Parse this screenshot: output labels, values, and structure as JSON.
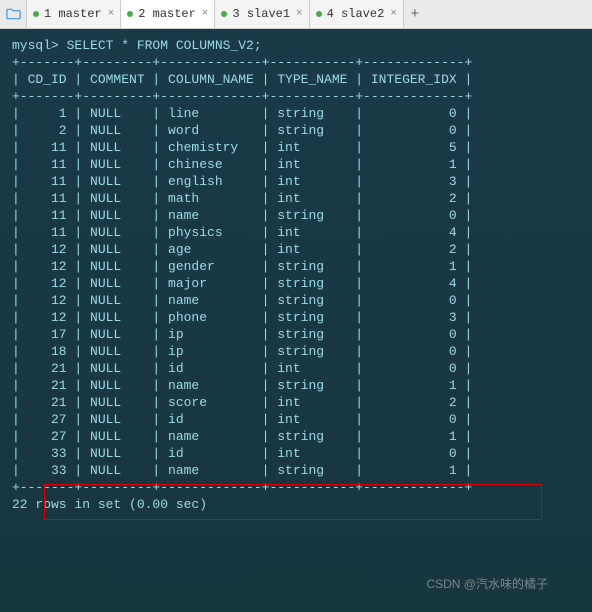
{
  "tabs": [
    {
      "label": "1 master"
    },
    {
      "label": "2 master"
    },
    {
      "label": "3 slave1"
    },
    {
      "label": "4 slave2"
    }
  ],
  "active_tab_index": 1,
  "prompt": "mysql> ",
  "query": "SELECT * FROM COLUMNS_V2;",
  "columns": [
    "CD_ID",
    "COMMENT",
    "COLUMN_NAME",
    "TYPE_NAME",
    "INTEGER_IDX"
  ],
  "rows": [
    {
      "cd_id": 1,
      "comment": "NULL",
      "column_name": "line",
      "type_name": "string",
      "integer_idx": 0
    },
    {
      "cd_id": 2,
      "comment": "NULL",
      "column_name": "word",
      "type_name": "string",
      "integer_idx": 0
    },
    {
      "cd_id": 11,
      "comment": "NULL",
      "column_name": "chemistry",
      "type_name": "int",
      "integer_idx": 5
    },
    {
      "cd_id": 11,
      "comment": "NULL",
      "column_name": "chinese",
      "type_name": "int",
      "integer_idx": 1
    },
    {
      "cd_id": 11,
      "comment": "NULL",
      "column_name": "english",
      "type_name": "int",
      "integer_idx": 3
    },
    {
      "cd_id": 11,
      "comment": "NULL",
      "column_name": "math",
      "type_name": "int",
      "integer_idx": 2
    },
    {
      "cd_id": 11,
      "comment": "NULL",
      "column_name": "name",
      "type_name": "string",
      "integer_idx": 0
    },
    {
      "cd_id": 11,
      "comment": "NULL",
      "column_name": "physics",
      "type_name": "int",
      "integer_idx": 4
    },
    {
      "cd_id": 12,
      "comment": "NULL",
      "column_name": "age",
      "type_name": "int",
      "integer_idx": 2
    },
    {
      "cd_id": 12,
      "comment": "NULL",
      "column_name": "gender",
      "type_name": "string",
      "integer_idx": 1
    },
    {
      "cd_id": 12,
      "comment": "NULL",
      "column_name": "major",
      "type_name": "string",
      "integer_idx": 4
    },
    {
      "cd_id": 12,
      "comment": "NULL",
      "column_name": "name",
      "type_name": "string",
      "integer_idx": 0
    },
    {
      "cd_id": 12,
      "comment": "NULL",
      "column_name": "phone",
      "type_name": "string",
      "integer_idx": 3
    },
    {
      "cd_id": 17,
      "comment": "NULL",
      "column_name": "ip",
      "type_name": "string",
      "integer_idx": 0
    },
    {
      "cd_id": 18,
      "comment": "NULL",
      "column_name": "ip",
      "type_name": "string",
      "integer_idx": 0
    },
    {
      "cd_id": 21,
      "comment": "NULL",
      "column_name": "id",
      "type_name": "int",
      "integer_idx": 0
    },
    {
      "cd_id": 21,
      "comment": "NULL",
      "column_name": "name",
      "type_name": "string",
      "integer_idx": 1
    },
    {
      "cd_id": 21,
      "comment": "NULL",
      "column_name": "score",
      "type_name": "int",
      "integer_idx": 2
    },
    {
      "cd_id": 27,
      "comment": "NULL",
      "column_name": "id",
      "type_name": "int",
      "integer_idx": 0
    },
    {
      "cd_id": 27,
      "comment": "NULL",
      "column_name": "name",
      "type_name": "string",
      "integer_idx": 1
    },
    {
      "cd_id": 33,
      "comment": "NULL",
      "column_name": "id",
      "type_name": "int",
      "integer_idx": 0
    },
    {
      "cd_id": 33,
      "comment": "NULL",
      "column_name": "name",
      "type_name": "string",
      "integer_idx": 1
    }
  ],
  "result_summary": "22 rows in set (0.00 sec)",
  "watermark": "CSDN @汽水味的橘子"
}
